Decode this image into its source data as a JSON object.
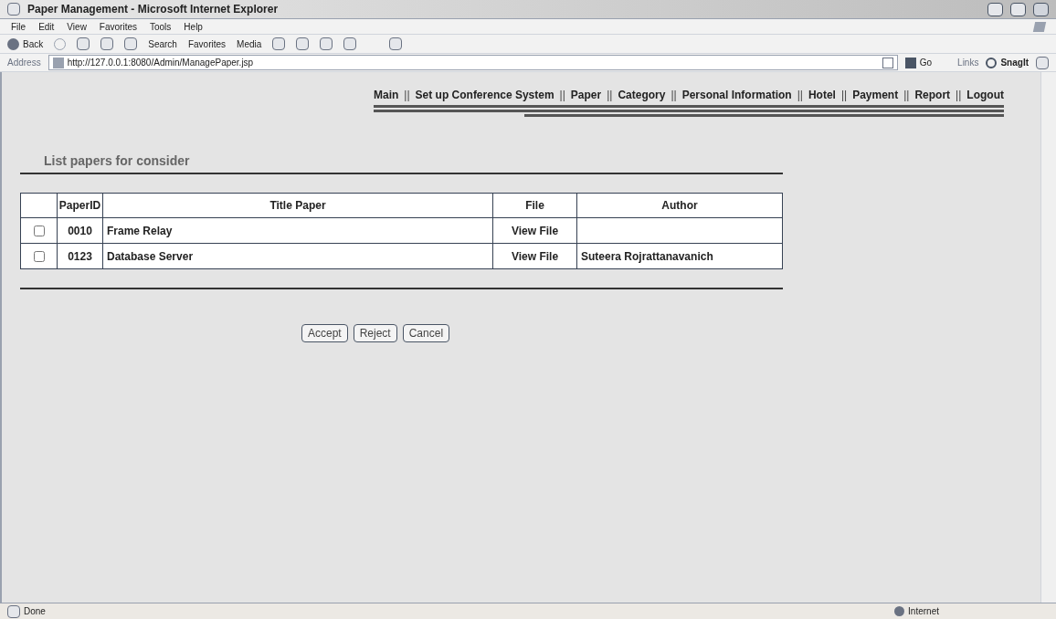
{
  "window": {
    "title": "Paper Management - Microsoft Internet Explorer"
  },
  "menu": [
    "File",
    "Edit",
    "View",
    "Favorites",
    "Tools",
    "Help"
  ],
  "toolbar": {
    "back": "Back",
    "search": "Search",
    "favorites": "Favorites",
    "media": "Media"
  },
  "address": {
    "label": "Address",
    "value": "http://127.0.0.1:8080/Admin/ManagePaper.jsp",
    "go": "Go",
    "links": "Links",
    "snagit": "SnagIt"
  },
  "nav": [
    {
      "kind": "link",
      "label": "Main"
    },
    {
      "kind": "separator",
      "label": "||"
    },
    {
      "kind": "link",
      "label": "Set up Conference System"
    },
    {
      "kind": "separator",
      "label": "||"
    },
    {
      "kind": "link",
      "label": "Paper"
    },
    {
      "kind": "separator",
      "label": "||"
    },
    {
      "kind": "link",
      "label": "Category"
    },
    {
      "kind": "separator",
      "label": "||"
    },
    {
      "kind": "link",
      "label": "Personal Information"
    },
    {
      "kind": "separator",
      "label": "||"
    },
    {
      "kind": "link",
      "label": "Hotel"
    },
    {
      "kind": "separator",
      "label": "||"
    },
    {
      "kind": "link",
      "label": "Payment"
    },
    {
      "kind": "separator",
      "label": "||"
    },
    {
      "kind": "link",
      "label": "Report"
    },
    {
      "kind": "separator",
      "label": "||"
    },
    {
      "kind": "link",
      "label": "Logout"
    }
  ],
  "heading": "List papers for consider",
  "table": {
    "columns": [
      "PaperID",
      "Title Paper",
      "File",
      "Author"
    ],
    "rows": [
      {
        "checked": false,
        "id": "0010",
        "title": "Frame Relay",
        "file": "View File"
      },
      {
        "checked": false,
        "id": "0123",
        "title": "Database Server",
        "file": "View File",
        "author": "Suteera Rojrattanavanich"
      }
    ]
  },
  "buttons": [
    "Accept",
    "Reject",
    "Cancel"
  ],
  "status_bar": {
    "text": "Done",
    "zone": "Internet"
  }
}
